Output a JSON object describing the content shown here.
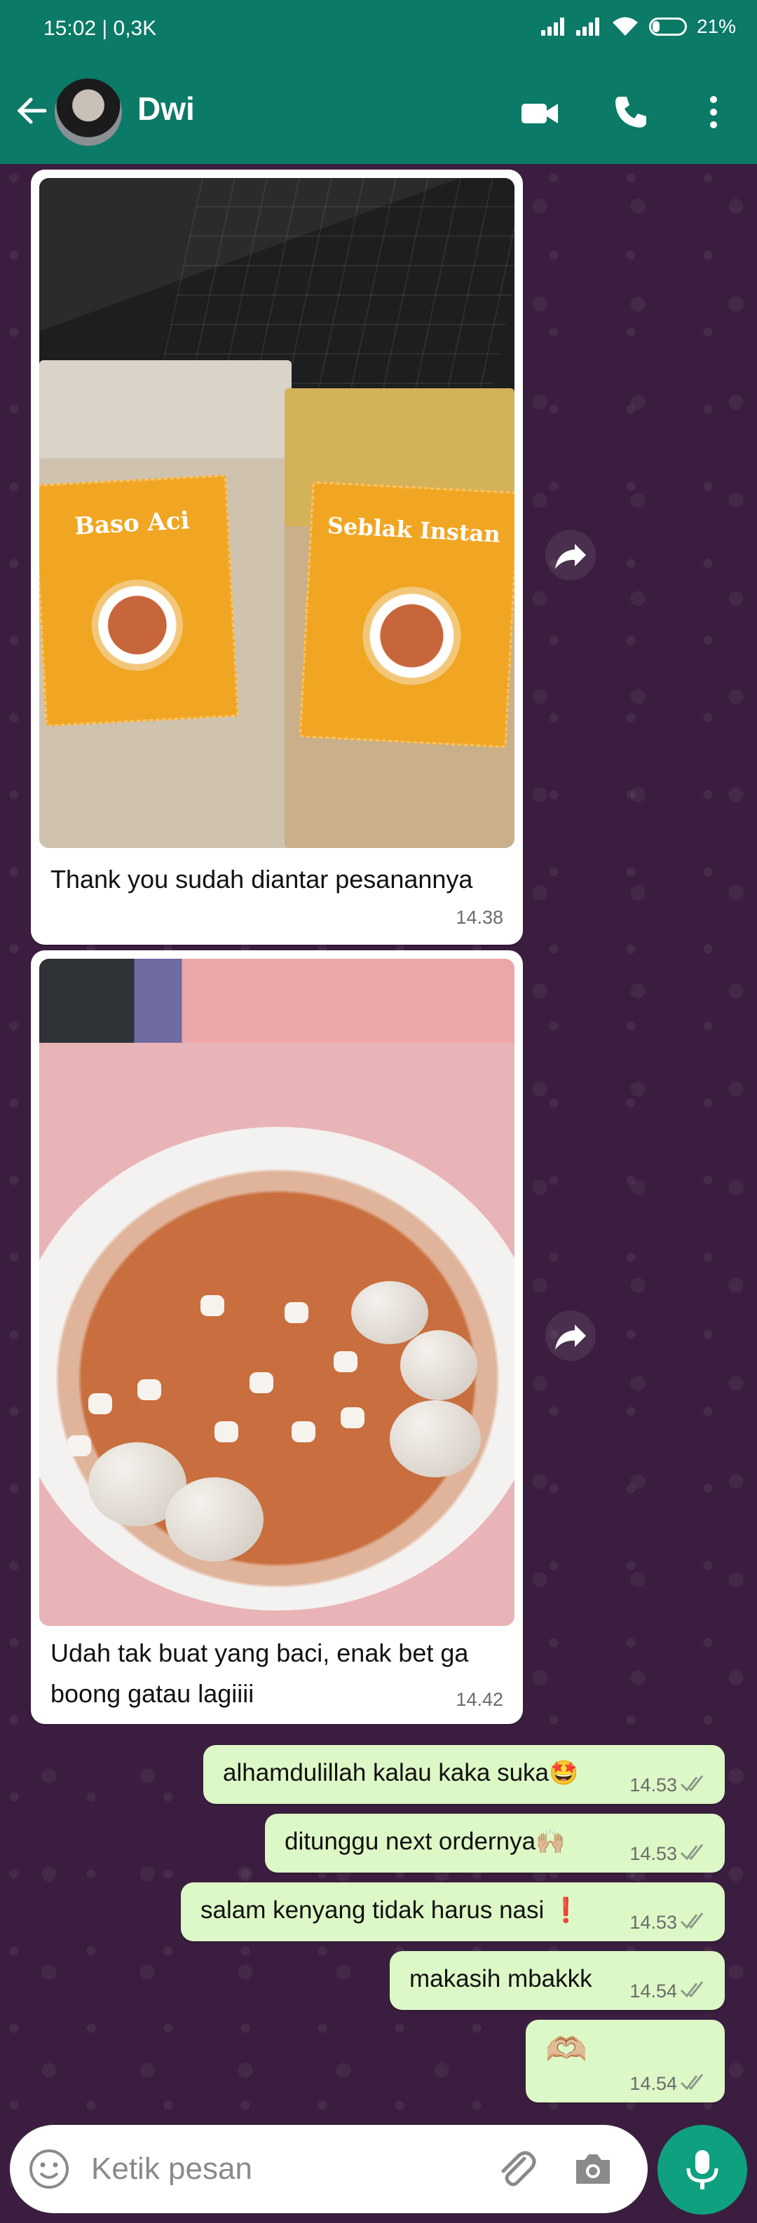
{
  "status_bar": {
    "time_data": "15:02 | 0,3K",
    "battery": "21%"
  },
  "header": {
    "contact_name": "Dwi"
  },
  "messages": [
    {
      "type": "image",
      "label_left": "Baso Aci",
      "label_right": "Seblak Instan",
      "caption": "Thank you sudah diantar pesanannya",
      "time": "14.38"
    },
    {
      "type": "image",
      "caption_line1": "Udah tak buat yang baci, enak bet ga",
      "caption_line2": "boong gatau lagiiii",
      "time": "14.42"
    }
  ],
  "outgoing": [
    {
      "text": "alhamdulillah kalau kaka suka",
      "emoji": "🤩",
      "time": "14.53"
    },
    {
      "text": "ditunggu next ordernya",
      "emoji": "🙌🏼",
      "time": "14.53"
    },
    {
      "text": "salam kenyang tidak harus nasi ",
      "emoji": "❗",
      "time": "14.53"
    },
    {
      "text": "makasih mbakkk",
      "emoji": "",
      "time": "14.54"
    },
    {
      "text": "",
      "emoji": "🫶🏼",
      "time": "14.54"
    }
  ],
  "input": {
    "placeholder": "Ketik pesan"
  },
  "colors": {
    "header": "#0b7a66",
    "outgoing": "#dcf8c6",
    "mic": "#0fa080",
    "chat_bg": "#3b1e3f"
  },
  "icons": [
    "back-arrow-icon",
    "video-call-icon",
    "phone-icon",
    "more-vert-icon",
    "forward-icon",
    "emoji-icon",
    "attach-icon",
    "camera-icon",
    "mic-icon",
    "double-check-icon"
  ]
}
